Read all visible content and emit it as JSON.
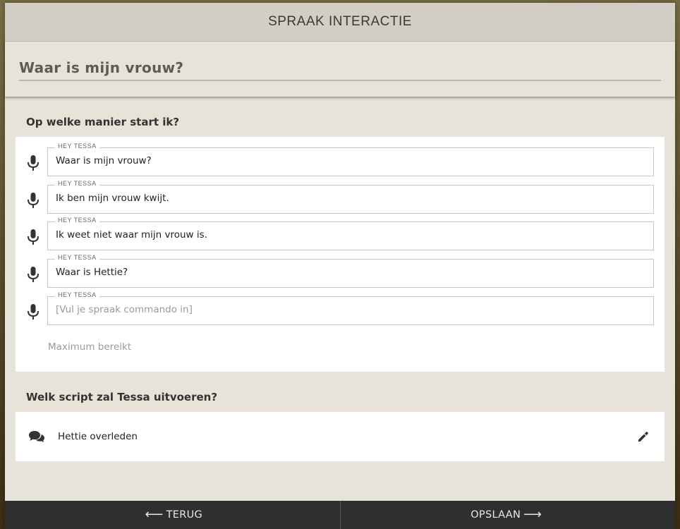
{
  "header": {
    "title": "SPRAAK INTERACTIE"
  },
  "interaction": {
    "name": "Waar is mijn vrouw?"
  },
  "triggers": {
    "label": "Op welke manier start ik?",
    "field_prefix": "HEY TESSA",
    "items": [
      {
        "value": "Waar is mijn vrouw?",
        "placeholder": ""
      },
      {
        "value": "Ik ben mijn vrouw kwijt.",
        "placeholder": ""
      },
      {
        "value": "Ik weet niet waar mijn vrouw is.",
        "placeholder": ""
      },
      {
        "value": "Waar is Hettie?",
        "placeholder": ""
      },
      {
        "value": "",
        "placeholder": "[Vul je spraak commando in]"
      }
    ],
    "max_note": "Maximum bereikt"
  },
  "script": {
    "label": "Welk script zal Tessa uitvoeren?",
    "name": "Hettie overleden",
    "icon": "chat-bubbles-icon",
    "edit_icon": "pencil-icon"
  },
  "footer": {
    "back_label": "TERUG",
    "save_label": "OPSLAAN"
  },
  "icons": {
    "mic": "microphone-icon"
  }
}
